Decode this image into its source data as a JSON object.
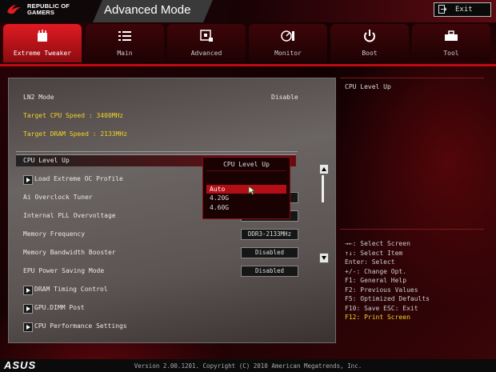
{
  "header": {
    "brand_line1": "REPUBLIC OF",
    "brand_line2": "GAMERS",
    "title": "Advanced Mode",
    "exit_label": "Exit"
  },
  "tabs": [
    {
      "label": "Extreme Tweaker",
      "icon": "tweaker-icon",
      "active": true
    },
    {
      "label": "Main",
      "icon": "list-icon",
      "active": false
    },
    {
      "label": "Advanced",
      "icon": "chip-icon",
      "active": false
    },
    {
      "label": "Monitor",
      "icon": "gauge-icon",
      "active": false
    },
    {
      "label": "Boot",
      "icon": "power-icon",
      "active": false
    },
    {
      "label": "Tool",
      "icon": "toolbox-icon",
      "active": false
    }
  ],
  "settings": {
    "ln2_label": "LN2 Mode",
    "ln2_value": "Disable",
    "target_cpu": "Target CPU Speed : 3400MHz",
    "target_dram": "Target DRAM Speed : 2133MHz",
    "cpu_level_up": "CPU Level Up",
    "load_extreme": "Load Extreme OC Profile",
    "ai_overclock": "Ai Overclock Tuner",
    "pll_overvoltage": "Internal PLL Overvoltage",
    "memory_frequency": "Memory Frequency",
    "memory_frequency_value": "DDR3-2133MHz",
    "memory_bandwidth": "Memory Bandwidth Booster",
    "memory_bandwidth_value": "Disabled",
    "epu_power": "EPU Power Saving Mode",
    "epu_power_value": "Disabled",
    "dram_timing": "DRAM Timing Control",
    "gpu_dimm": "GPU.DIMM Post",
    "cpu_perf": "CPU Performance Settings"
  },
  "popup": {
    "title": "CPU Level Up",
    "options": [
      "Auto",
      "4.20G",
      "4.60G"
    ],
    "selected": "Auto"
  },
  "help": {
    "title": "CPU Level Up"
  },
  "keys": [
    "→←: Select Screen",
    "↑↓: Select Item",
    "Enter: Select",
    "+/-: Change Opt.",
    "F1: General Help",
    "F2: Previous Values",
    "F5: Optimized Defaults",
    "F10: Save  ESC: Exit",
    "F12: Print Screen"
  ],
  "footer": {
    "logo": "ASUS",
    "version": "Version 2.00.1201. Copyright (C) 2010 American Megatrends, Inc."
  },
  "colors": {
    "accent": "#c00a12",
    "highlight_text": "#f2d324",
    "selection": "#b30d15"
  }
}
